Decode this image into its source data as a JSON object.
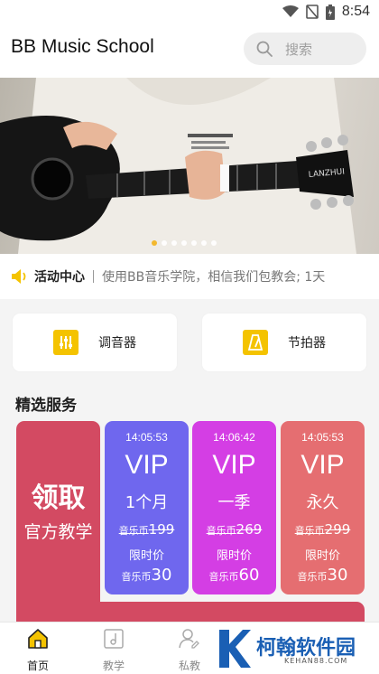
{
  "status_bar": {
    "time": "8:54"
  },
  "header": {
    "title": "BB Music School",
    "search_placeholder": "搜索"
  },
  "banner": {
    "slide_count": 7,
    "active_index": 0,
    "guitar_brand": "LANZHUI"
  },
  "notice": {
    "label": "活动中心",
    "text": "使用BB音乐学院，相信我们包教会; 1天"
  },
  "tools": [
    {
      "label": "调音器",
      "icon": "tuner-icon"
    },
    {
      "label": "节拍器",
      "icon": "metronome-icon"
    }
  ],
  "section": {
    "title": "精选服务"
  },
  "free_card": {
    "title": "领取",
    "subtitle": "官方教学"
  },
  "vip_cards": [
    {
      "time": "14:05:53",
      "vip": "VIP",
      "period": "1个月",
      "orig_unit": "音乐币",
      "orig_price": "199",
      "limit": "限时价",
      "price_unit": "音乐币",
      "price": "30"
    },
    {
      "time": "14:06:42",
      "vip": "VIP",
      "period": "一季",
      "orig_unit": "音乐币",
      "orig_price": "269",
      "limit": "限时价",
      "price_unit": "音乐币",
      "price": "60"
    },
    {
      "time": "14:05:53",
      "vip": "VIP",
      "period": "永久",
      "orig_unit": "音乐币",
      "orig_price": "299",
      "limit": "限时价",
      "price_unit": "音乐币",
      "price": "30"
    }
  ],
  "bottom_nav": [
    {
      "label": "首页",
      "icon": "home-icon",
      "active": true
    },
    {
      "label": "教学",
      "icon": "music-note-icon",
      "active": false
    },
    {
      "label": "私教",
      "icon": "tutor-icon",
      "active": false
    }
  ],
  "watermark": {
    "text": "柯翰软件园",
    "url": "KEHAN88.COM"
  },
  "colors": {
    "vip_month": "#6f67ee",
    "vip_season": "#d43ee4",
    "vip_forever": "#e56e71",
    "free": "#d34a62",
    "accent": "#f4c300"
  }
}
